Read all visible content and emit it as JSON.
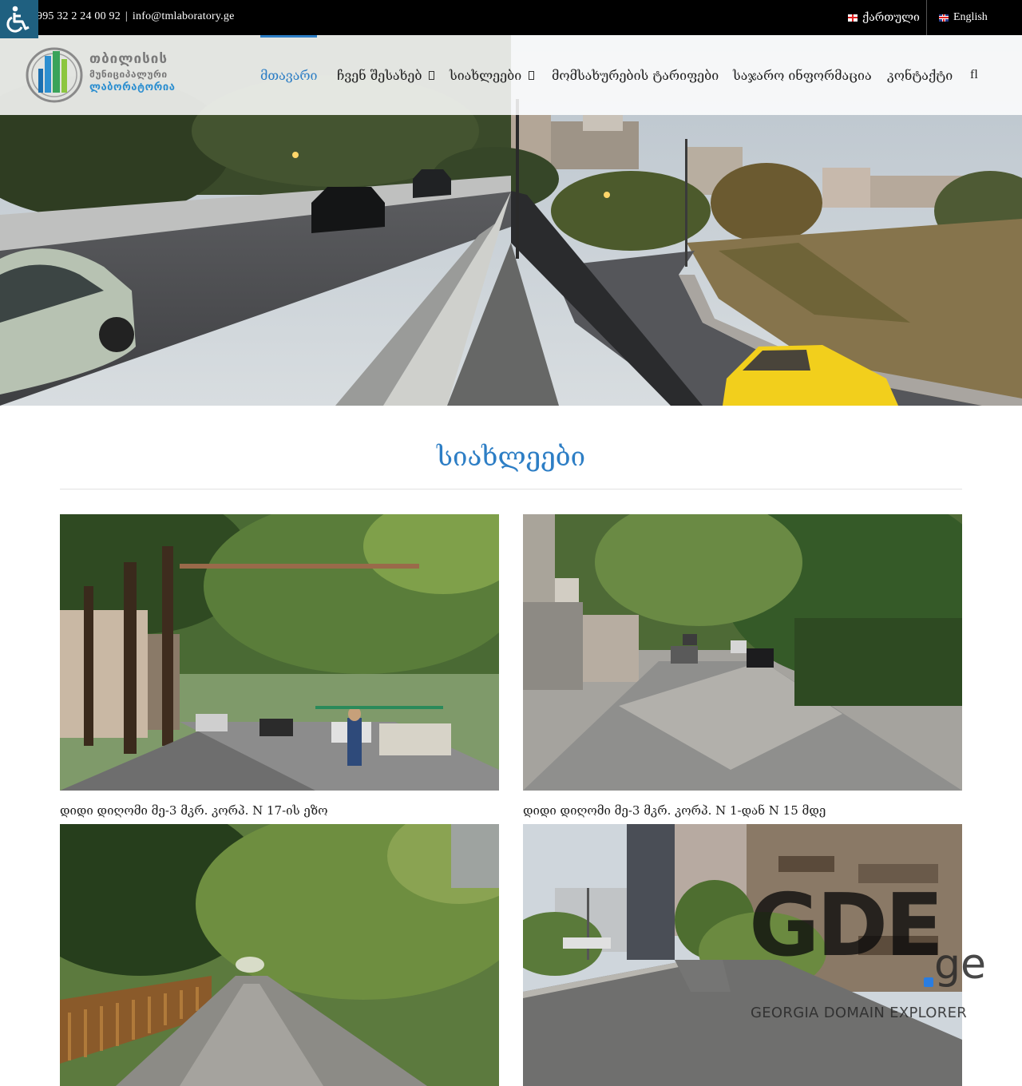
{
  "topbar": {
    "phone": "995 32 2 24 00 92",
    "separator": "|",
    "email": "info@tmlaboratory.ge",
    "languages": [
      {
        "label": "ქართული",
        "flag": "georgia-flag-icon"
      },
      {
        "label": "English",
        "flag": "uk-flag-icon"
      }
    ],
    "accessibility_icon": "wheelchair-icon"
  },
  "logo": {
    "line1": "თბილისის",
    "line2": "მუნიციპალური",
    "line3": "ლაბორატორია"
  },
  "nav": {
    "items": [
      {
        "label": "მთავარი",
        "active": true,
        "has_submenu": false
      },
      {
        "label": "ჩვენ შესახებ",
        "active": false,
        "has_submenu": true
      },
      {
        "label": "სიახლეები",
        "active": false,
        "has_submenu": true
      },
      {
        "label": "მომსახურების ტარიფები",
        "active": false,
        "has_submenu": false
      },
      {
        "label": "საჯარო ინფორმაცია",
        "active": false,
        "has_submenu": false
      },
      {
        "label": "კონტაქტი",
        "active": false,
        "has_submenu": false
      }
    ],
    "search_icon": "fl"
  },
  "section": {
    "title": "სიახლეები"
  },
  "news": [
    {
      "caption": "დიდი დიღომი მე-3 მკრ. კორპ. N 17-ის ეზო",
      "image": "tree-lined-courtyard-road-photo"
    },
    {
      "caption": "დიდი დიღომი მე-3 მკრ. კორპ. N 1-დან N 15 მდე",
      "image": "asphalt-street-with-garages-photo"
    },
    {
      "caption": "",
      "image": "green-alley-road-photo"
    },
    {
      "caption": "",
      "image": "apartment-courtyard-road-photo"
    }
  ],
  "watermark": {
    "brand": "GDE",
    "tld": "ge",
    "tagline": "GEORGIA DOMAIN EXPLORER"
  },
  "colors": {
    "accent": "#2d7ec5",
    "topbar": "#000000",
    "accessibility": "#1f6080"
  }
}
